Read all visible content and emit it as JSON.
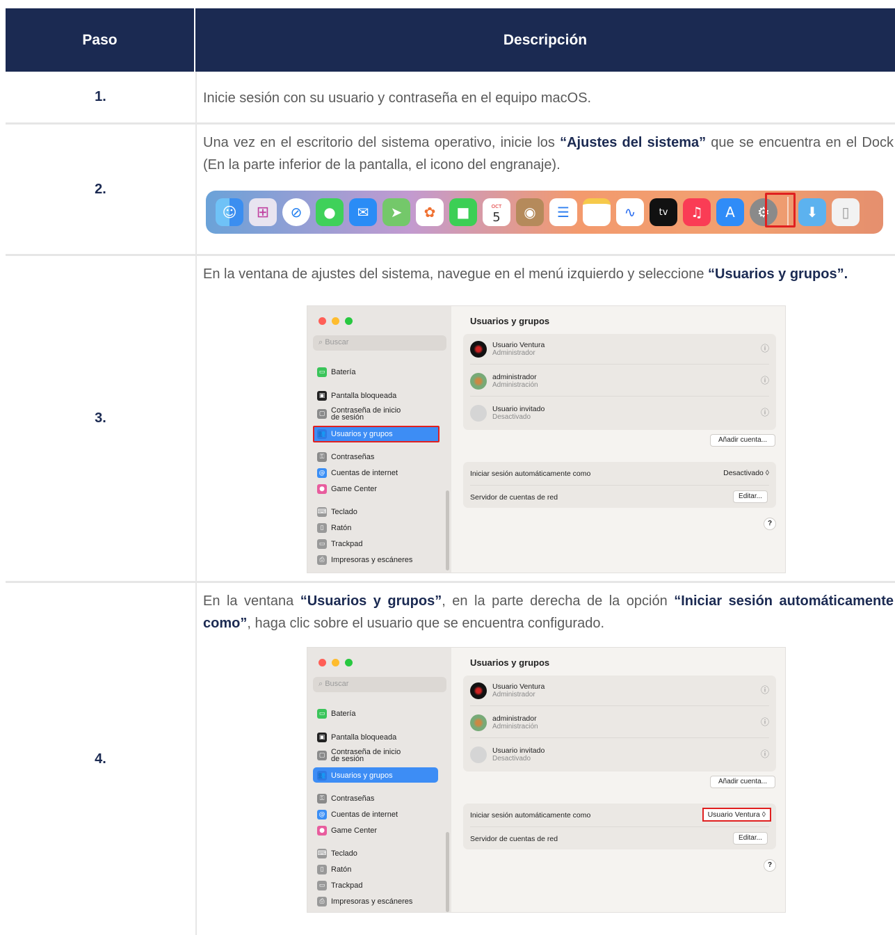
{
  "table": {
    "headers": {
      "step": "Paso",
      "description": "Descripción"
    },
    "rows": [
      {
        "step": "1.",
        "text": "Inicie sesión con su usuario y contraseña en el equipo macOS."
      },
      {
        "step": "2.",
        "text_before": "Una vez en el escritorio del sistema operativo, inicie los ",
        "bold": "“Ajustes del sistema”",
        "text_after": " que se encuentra en el Dock (En la parte inferior de la pantalla, el icono del engranaje)."
      },
      {
        "step": "3.",
        "text_before": "En la ventana de ajustes del sistema, navegue en el menú izquierdo y seleccione ",
        "bold": "“Usuarios y grupos”.",
        "text_after": ""
      },
      {
        "step": "4.",
        "text_before": "En la ventana ",
        "bold": "“Usuarios y grupos”",
        "text_middle": ", en la parte derecha de la opción ",
        "bold2": "“Iniciar sesión automáticamente como”",
        "text_after": ", haga clic sobre el usuario que se encuentra configurado."
      }
    ]
  },
  "dock": {
    "calendar_month": "OCT",
    "calendar_day": "5",
    "tv_label": "tv",
    "icons": [
      "finder-icon",
      "launchpad-icon",
      "safari-icon",
      "messages-icon",
      "mail-icon",
      "maps-icon",
      "photos-icon",
      "facetime-icon",
      "calendar-icon",
      "contacts-icon",
      "reminders-icon",
      "notes-icon",
      "freeform-icon",
      "apple-tv-icon",
      "music-icon",
      "app-store-icon",
      "system-settings-icon",
      "downloads-icon",
      "trash-icon"
    ]
  },
  "settings_window": {
    "search_placeholder": "Buscar",
    "sidebar": {
      "battery": "Batería",
      "lock_screen": "Pantalla bloqueada",
      "login_password_1": "Contraseña de inicio",
      "login_password_2": "de sesión",
      "users_groups": "Usuarios y grupos",
      "passwords": "Contraseñas",
      "internet_accounts": "Cuentas de internet",
      "game_center": "Game Center",
      "keyboard": "Teclado",
      "mouse": "Ratón",
      "trackpad": "Trackpad",
      "printers": "Impresoras y escáneres"
    },
    "title": "Usuarios y grupos",
    "users": [
      {
        "name": "Usuario Ventura",
        "role": "Administrador"
      },
      {
        "name": "administrador",
        "role": "Administración"
      },
      {
        "name": "Usuario invitado",
        "role": "Desactivado"
      }
    ],
    "add_account": "Añadir cuenta...",
    "auto_login_label": "Iniciar sesión automáticamente como",
    "auto_login_value_step3": "Desactivado ◊",
    "auto_login_value_step4": "Usuario Ventura ◊",
    "network_server_label": "Servidor de cuentas de red",
    "edit": "Editar...",
    "help": "?"
  },
  "colors": {
    "header_bg": "#1b2a52",
    "highlight": "#e02020",
    "selected": "#3d8df5"
  }
}
